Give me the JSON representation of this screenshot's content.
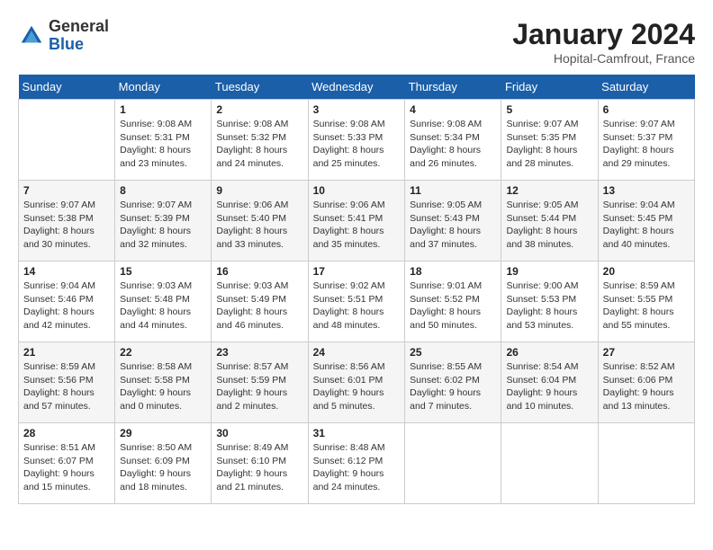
{
  "header": {
    "logo_general": "General",
    "logo_blue": "Blue",
    "month_title": "January 2024",
    "location": "Hopital-Camfrout, France"
  },
  "days_of_week": [
    "Sunday",
    "Monday",
    "Tuesday",
    "Wednesday",
    "Thursday",
    "Friday",
    "Saturday"
  ],
  "weeks": [
    [
      {
        "num": "",
        "info": ""
      },
      {
        "num": "1",
        "info": "Sunrise: 9:08 AM\nSunset: 5:31 PM\nDaylight: 8 hours\nand 23 minutes."
      },
      {
        "num": "2",
        "info": "Sunrise: 9:08 AM\nSunset: 5:32 PM\nDaylight: 8 hours\nand 24 minutes."
      },
      {
        "num": "3",
        "info": "Sunrise: 9:08 AM\nSunset: 5:33 PM\nDaylight: 8 hours\nand 25 minutes."
      },
      {
        "num": "4",
        "info": "Sunrise: 9:08 AM\nSunset: 5:34 PM\nDaylight: 8 hours\nand 26 minutes."
      },
      {
        "num": "5",
        "info": "Sunrise: 9:07 AM\nSunset: 5:35 PM\nDaylight: 8 hours\nand 28 minutes."
      },
      {
        "num": "6",
        "info": "Sunrise: 9:07 AM\nSunset: 5:37 PM\nDaylight: 8 hours\nand 29 minutes."
      }
    ],
    [
      {
        "num": "7",
        "info": "Sunrise: 9:07 AM\nSunset: 5:38 PM\nDaylight: 8 hours\nand 30 minutes."
      },
      {
        "num": "8",
        "info": "Sunrise: 9:07 AM\nSunset: 5:39 PM\nDaylight: 8 hours\nand 32 minutes."
      },
      {
        "num": "9",
        "info": "Sunrise: 9:06 AM\nSunset: 5:40 PM\nDaylight: 8 hours\nand 33 minutes."
      },
      {
        "num": "10",
        "info": "Sunrise: 9:06 AM\nSunset: 5:41 PM\nDaylight: 8 hours\nand 35 minutes."
      },
      {
        "num": "11",
        "info": "Sunrise: 9:05 AM\nSunset: 5:43 PM\nDaylight: 8 hours\nand 37 minutes."
      },
      {
        "num": "12",
        "info": "Sunrise: 9:05 AM\nSunset: 5:44 PM\nDaylight: 8 hours\nand 38 minutes."
      },
      {
        "num": "13",
        "info": "Sunrise: 9:04 AM\nSunset: 5:45 PM\nDaylight: 8 hours\nand 40 minutes."
      }
    ],
    [
      {
        "num": "14",
        "info": "Sunrise: 9:04 AM\nSunset: 5:46 PM\nDaylight: 8 hours\nand 42 minutes."
      },
      {
        "num": "15",
        "info": "Sunrise: 9:03 AM\nSunset: 5:48 PM\nDaylight: 8 hours\nand 44 minutes."
      },
      {
        "num": "16",
        "info": "Sunrise: 9:03 AM\nSunset: 5:49 PM\nDaylight: 8 hours\nand 46 minutes."
      },
      {
        "num": "17",
        "info": "Sunrise: 9:02 AM\nSunset: 5:51 PM\nDaylight: 8 hours\nand 48 minutes."
      },
      {
        "num": "18",
        "info": "Sunrise: 9:01 AM\nSunset: 5:52 PM\nDaylight: 8 hours\nand 50 minutes."
      },
      {
        "num": "19",
        "info": "Sunrise: 9:00 AM\nSunset: 5:53 PM\nDaylight: 8 hours\nand 53 minutes."
      },
      {
        "num": "20",
        "info": "Sunrise: 8:59 AM\nSunset: 5:55 PM\nDaylight: 8 hours\nand 55 minutes."
      }
    ],
    [
      {
        "num": "21",
        "info": "Sunrise: 8:59 AM\nSunset: 5:56 PM\nDaylight: 8 hours\nand 57 minutes."
      },
      {
        "num": "22",
        "info": "Sunrise: 8:58 AM\nSunset: 5:58 PM\nDaylight: 9 hours\nand 0 minutes."
      },
      {
        "num": "23",
        "info": "Sunrise: 8:57 AM\nSunset: 5:59 PM\nDaylight: 9 hours\nand 2 minutes."
      },
      {
        "num": "24",
        "info": "Sunrise: 8:56 AM\nSunset: 6:01 PM\nDaylight: 9 hours\nand 5 minutes."
      },
      {
        "num": "25",
        "info": "Sunrise: 8:55 AM\nSunset: 6:02 PM\nDaylight: 9 hours\nand 7 minutes."
      },
      {
        "num": "26",
        "info": "Sunrise: 8:54 AM\nSunset: 6:04 PM\nDaylight: 9 hours\nand 10 minutes."
      },
      {
        "num": "27",
        "info": "Sunrise: 8:52 AM\nSunset: 6:06 PM\nDaylight: 9 hours\nand 13 minutes."
      }
    ],
    [
      {
        "num": "28",
        "info": "Sunrise: 8:51 AM\nSunset: 6:07 PM\nDaylight: 9 hours\nand 15 minutes."
      },
      {
        "num": "29",
        "info": "Sunrise: 8:50 AM\nSunset: 6:09 PM\nDaylight: 9 hours\nand 18 minutes."
      },
      {
        "num": "30",
        "info": "Sunrise: 8:49 AM\nSunset: 6:10 PM\nDaylight: 9 hours\nand 21 minutes."
      },
      {
        "num": "31",
        "info": "Sunrise: 8:48 AM\nSunset: 6:12 PM\nDaylight: 9 hours\nand 24 minutes."
      },
      {
        "num": "",
        "info": ""
      },
      {
        "num": "",
        "info": ""
      },
      {
        "num": "",
        "info": ""
      }
    ]
  ]
}
